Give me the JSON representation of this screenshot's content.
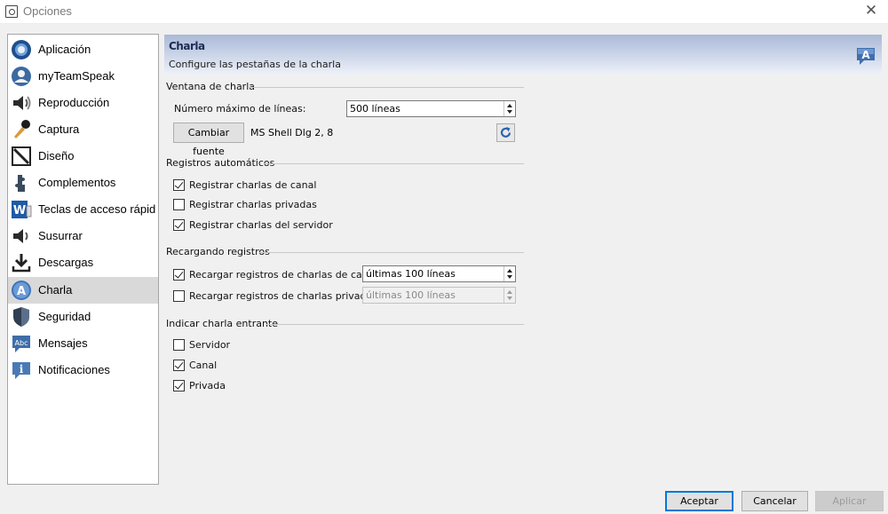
{
  "window": {
    "title": "Opciones",
    "close_label": "✕"
  },
  "sidebar": {
    "items": [
      {
        "label": "Aplicación",
        "icon": "application-icon"
      },
      {
        "label": "myTeamSpeak",
        "icon": "user-icon"
      },
      {
        "label": "Reproducción",
        "icon": "speaker-icon"
      },
      {
        "label": "Captura",
        "icon": "microphone-icon"
      },
      {
        "label": "Diseño",
        "icon": "design-icon"
      },
      {
        "label": "Complementos",
        "icon": "puzzle-icon"
      },
      {
        "label": "Teclas de acceso rápido",
        "icon": "hotkey-icon"
      },
      {
        "label": "Susurrar",
        "icon": "whisper-speaker-icon"
      },
      {
        "label": "Descargas",
        "icon": "download-icon"
      },
      {
        "label": "Charla",
        "icon": "chat-icon",
        "selected": true
      },
      {
        "label": "Seguridad",
        "icon": "shield-icon"
      },
      {
        "label": "Mensajes",
        "icon": "messages-icon"
      },
      {
        "label": "Notificaciones",
        "icon": "info-icon"
      }
    ]
  },
  "header": {
    "title": "Charla",
    "subtitle": "Configure las pestañas de la charla",
    "icon": "chat-icon"
  },
  "chat_window": {
    "label": "Ventana de charla",
    "max_lines_label": "Número máximo de líneas:",
    "max_lines_value": "500 líneas",
    "change_font_label": "Cambiar fuente",
    "font_value": "MS Shell Dlg 2, 8"
  },
  "auto_logs": {
    "label": "Registros automáticos",
    "options": [
      {
        "label": "Registrar charlas de canal",
        "checked": true
      },
      {
        "label": "Registrar charlas privadas",
        "checked": false
      },
      {
        "label": "Registrar charlas del servidor",
        "checked": true
      }
    ]
  },
  "reload_logs": {
    "label": "Recargando registros",
    "options": [
      {
        "label": "Recargar registros de charlas de canal",
        "checked": true,
        "value": "últimas 100 líneas",
        "enabled": true
      },
      {
        "label": "Recargar registros de charlas privadas",
        "checked": false,
        "value": "últimas 100 líneas",
        "enabled": false
      }
    ]
  },
  "incoming": {
    "label": "Indicar charla entrante",
    "options": [
      {
        "label": "Servidor",
        "checked": false
      },
      {
        "label": "Canal",
        "checked": true
      },
      {
        "label": "Privada",
        "checked": true
      }
    ]
  },
  "buttons": {
    "ok": "Aceptar",
    "cancel": "Cancelar",
    "apply": "Aplicar"
  },
  "colors": {
    "selection": "#d9d9d9",
    "accent": "#0078d7",
    "header_gradient_top": "#aab9d6"
  }
}
